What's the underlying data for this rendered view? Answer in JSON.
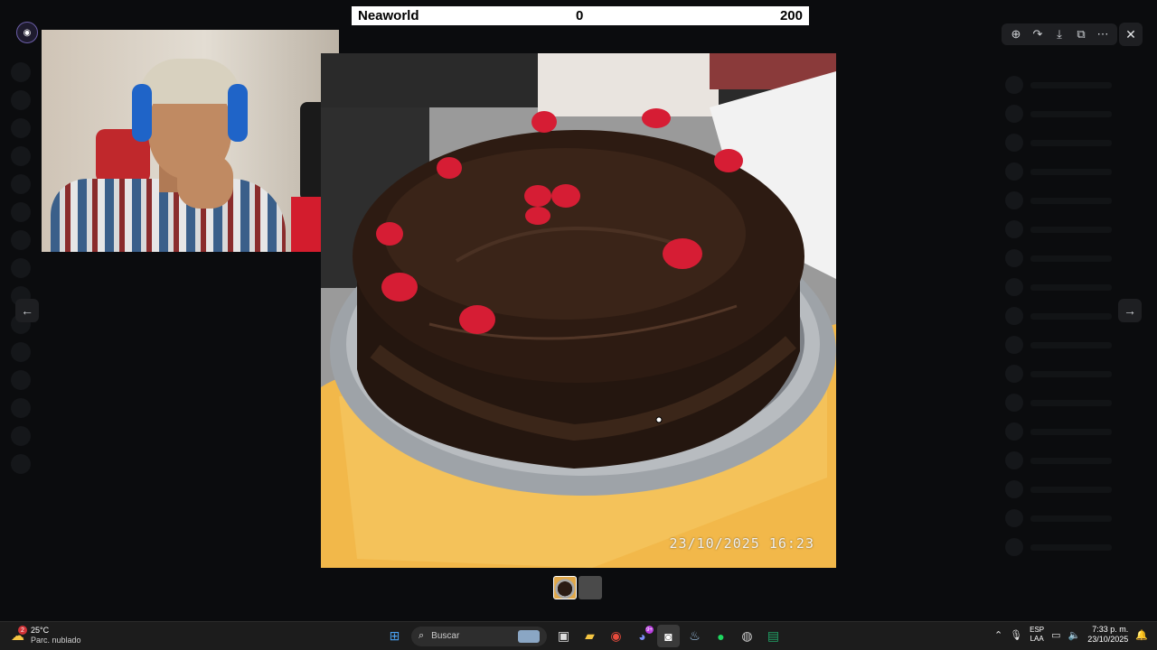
{
  "scoreboard": {
    "name": "Neaworld",
    "score_left": "0",
    "score_right": "200"
  },
  "photo": {
    "timestamp": "23/10/2025  16:23"
  },
  "viewer": {
    "toolbar_icons": [
      "zoom-in-icon",
      "forward-icon",
      "download-icon",
      "open-external-icon",
      "more-icon"
    ],
    "close_icon": "close-icon"
  },
  "taskbar": {
    "weather": {
      "temp": "25°C",
      "desc": "Parc. nublado",
      "badge": "2"
    },
    "search_placeholder": "Buscar",
    "discord_badge": "9+",
    "lang_top": "ESP",
    "lang_bottom": "LAA",
    "time": "7:33 p. m.",
    "date": "23/10/2025"
  },
  "colors": {
    "accent_red": "#d31c2d",
    "headphones_blue": "#1f64c8",
    "taskbar_bg": "#1c1c1c"
  }
}
